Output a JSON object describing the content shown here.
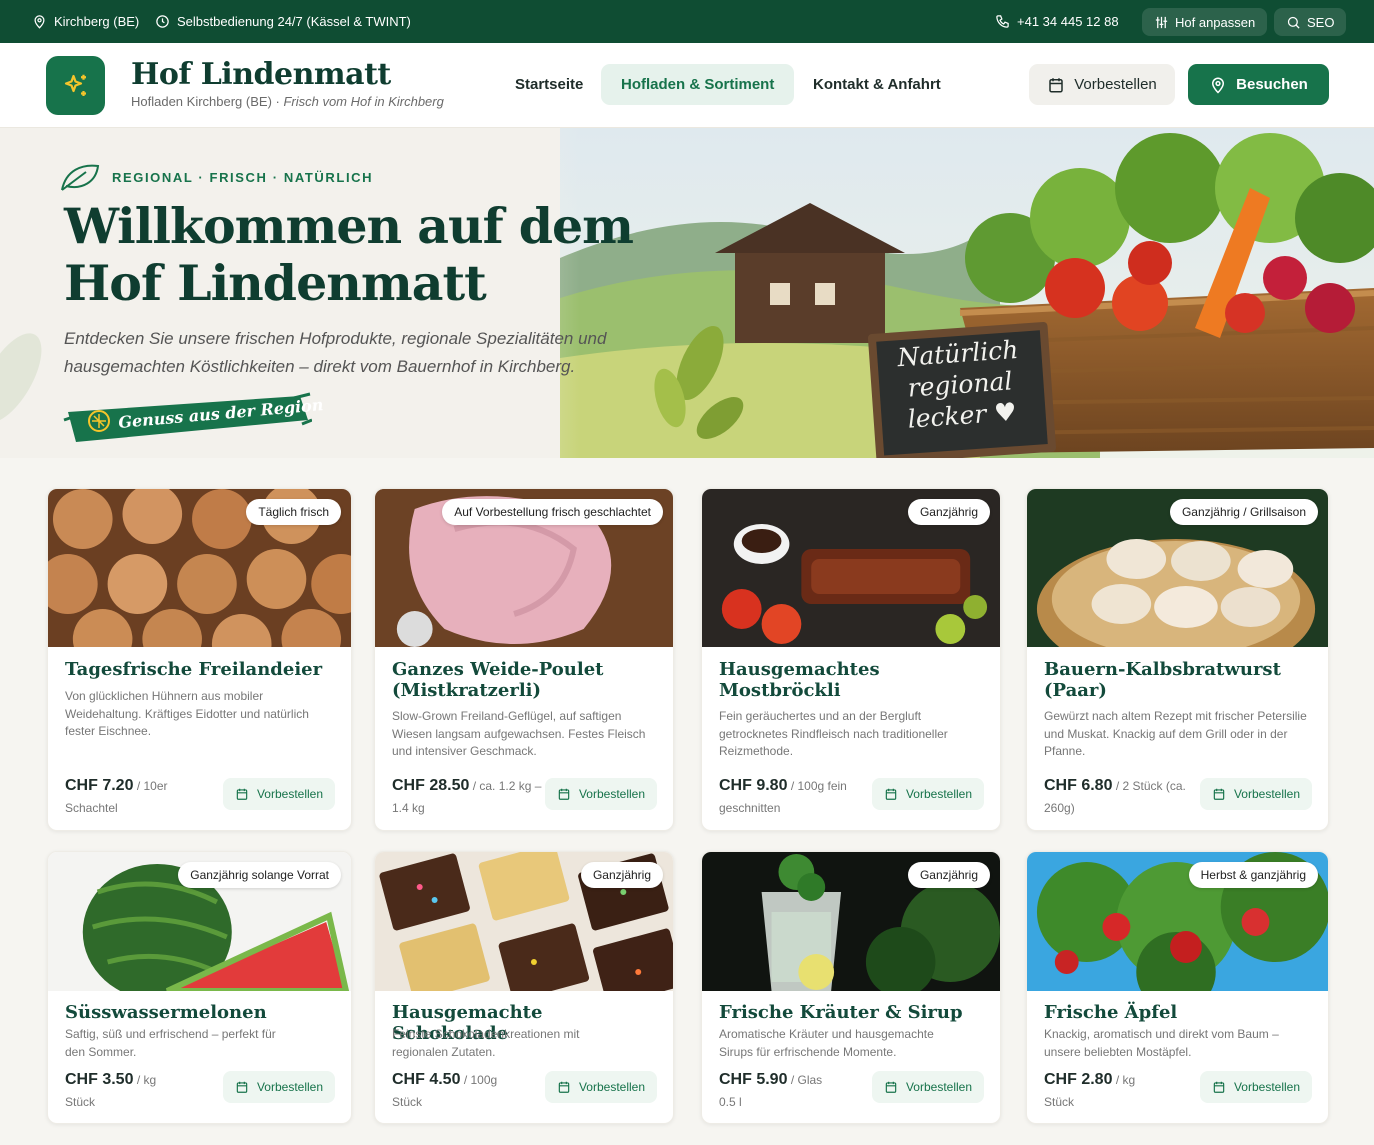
{
  "topbar": {
    "location": "Kirchberg (BE)",
    "hours": "Selbstbedienung 24/7 (Kässel & TWINT)",
    "phone": "+41 34 445 12 88",
    "customize": "Hof anpassen",
    "seo": "SEO"
  },
  "header": {
    "title": "Hof Lindenmatt",
    "subtitle_plain": "Hofladen Kirchberg (BE) · ",
    "subtitle_italic": "Frisch vom Hof in Kirchberg",
    "nav": [
      "Startseite",
      "Hofladen & Sortiment",
      "Kontakt & Anfahrt"
    ],
    "preorder": "Vorbestellen",
    "visit": "Besuchen"
  },
  "hero": {
    "eyebrow": "REGIONAL · FRISCH · NATÜRLICH",
    "title": "Willkommen auf dem Hof Lindenmatt",
    "text": "Entdecken Sie unsere frischen Hofprodukte, regionale Spezialitäten und hausgemachten Köstlichkeiten – direkt vom Bauernhof in Kirchberg.",
    "badge": "Genuss aus der Region",
    "chalkboard": [
      "Natürlich",
      "regional",
      "lecker ♥"
    ]
  },
  "products": [
    {
      "tag": "Täglich frisch",
      "title": "Tagesfrische Freilandeier",
      "desc": "Von glücklichen Hühnern aus mobiler Weidehaltung. Kräftiges Eidotter und natürlich fester Eischnee.",
      "price": "CHF 7.20",
      "unit": "/ 10er Schachtel",
      "button": "Vorbestellen"
    },
    {
      "tag": "Auf Vorbestellung frisch geschlachtet",
      "title": "Ganzes Weide-Poulet (Mistkratzerli)",
      "desc": "Slow-Grown Freiland-Geflügel, auf saftigen Wiesen langsam aufgewachsen. Festes Fleisch und intensiver Geschmack.",
      "price": "CHF 28.50",
      "unit": "/ ca. 1.2 kg – 1.4 kg",
      "button": "Vorbestellen"
    },
    {
      "tag": "Ganzjährig",
      "title": "Hausgemachtes Mostbröckli",
      "desc": "Fein geräuchertes und an der Bergluft getrocknetes Rindfleisch nach traditioneller Reizmethode.",
      "price": "CHF 9.80",
      "unit": "/ 100g fein geschnitten",
      "button": "Vorbestellen"
    },
    {
      "tag": "Ganzjährig / Grillsaison",
      "title": "Bauern-Kalbsbratwurst (Paar)",
      "desc": "Gewürzt nach altem Rezept mit frischer Petersilie und Muskat. Knackig auf dem Grill oder in der Pfanne.",
      "price": "CHF 6.80",
      "unit": "/ 2 Stück (ca. 260g)",
      "button": "Vorbestellen"
    },
    {
      "tag": "Ganzjährig solange Vorrat",
      "title": "Süsswassermelonen",
      "desc": "Saftig, süß und erfrischend – perfekt für den Sommer.",
      "price": "CHF 3.50",
      "unit": "/ kg Stück",
      "button": "Vorbestellen"
    },
    {
      "tag": "Ganzjährig",
      "title": "Hausgemachte Schokolade",
      "desc": "Feinste Schokoladenkreationen mit regionalen Zutaten.",
      "price": "CHF 4.50",
      "unit": "/ 100g Stück",
      "button": "Vorbestellen"
    },
    {
      "tag": "Ganzjährig",
      "title": "Frische Kräuter & Sirup",
      "desc": "Aromatische Kräuter und hausgemachte Sirups für erfrischende Momente.",
      "price": "CHF 5.90",
      "unit": "/ Glas 0.5 l",
      "button": "Vorbestellen"
    },
    {
      "tag": "Herbst & ganzjährig",
      "title": "Frische Äpfel",
      "desc": "Knackig, aromatisch und direkt vom Baum – unsere beliebten Mostäpfel.",
      "price": "CHF 2.80",
      "unit": "/ kg Stück",
      "button": "Vorbestellen"
    }
  ],
  "colors": {
    "brand_green": "#17734b",
    "topbar_green": "#0f4d33",
    "title_green": "#0f3d30"
  }
}
